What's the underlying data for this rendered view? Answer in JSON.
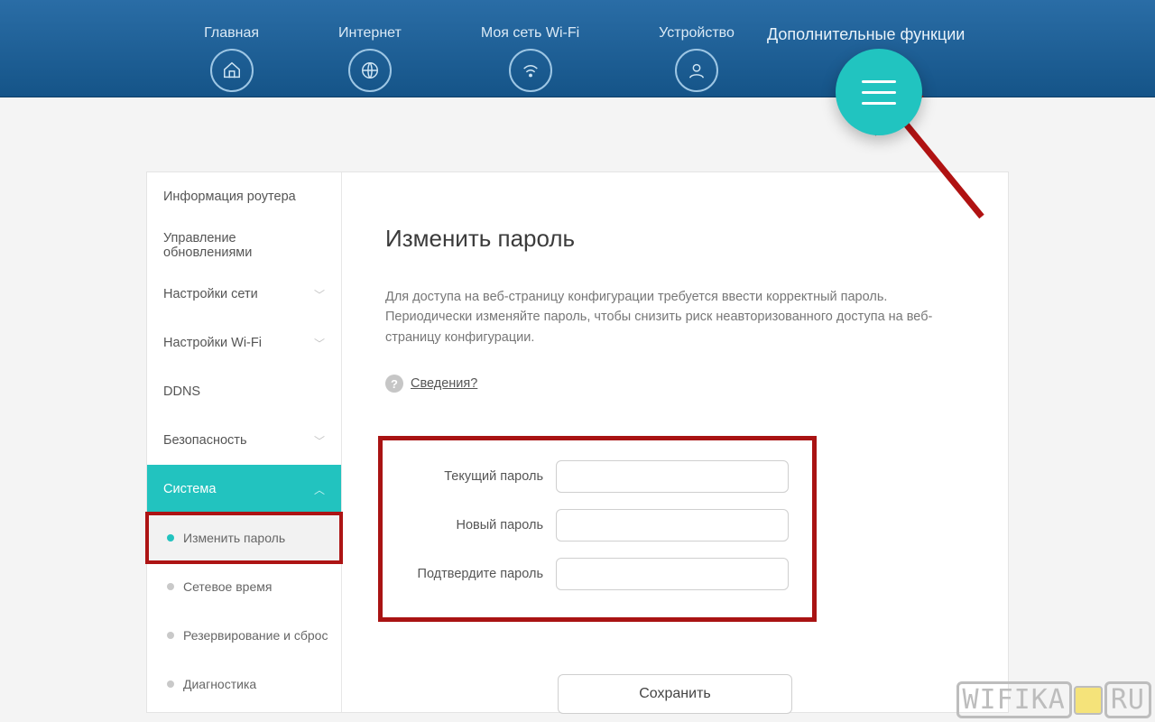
{
  "topnav": {
    "items": [
      {
        "label": "Главная"
      },
      {
        "label": "Интернет"
      },
      {
        "label": "Моя сеть Wi-Fi"
      },
      {
        "label": "Устройство"
      }
    ],
    "extra_label": "Дополнительные функции"
  },
  "sidebar": {
    "items": [
      {
        "label": "Информация роутера",
        "expandable": false
      },
      {
        "label": "Управление обновлениями",
        "expandable": false
      },
      {
        "label": "Настройки сети",
        "expandable": true
      },
      {
        "label": "Настройки Wi-Fi",
        "expandable": true
      },
      {
        "label": "DDNS",
        "expandable": false
      },
      {
        "label": "Безопасность",
        "expandable": true
      }
    ],
    "active_group": "Система",
    "sub_items": [
      {
        "label": "Изменить пароль",
        "selected": true
      },
      {
        "label": "Сетевое время"
      },
      {
        "label": "Резервирование и сброс"
      },
      {
        "label": "Диагностика"
      }
    ]
  },
  "page": {
    "title": "Изменить пароль",
    "description": "Для доступа на веб-страницу конфигурации требуется ввести корректный пароль. Периодически изменяйте пароль, чтобы снизить риск неавторизованного доступа на веб-страницу конфигурации.",
    "info_link": "Сведения?",
    "labels": {
      "current": "Текущий пароль",
      "new": "Новый пароль",
      "confirm": "Подтвердите пароль"
    },
    "save": "Сохранить"
  },
  "watermark": {
    "text1": "WIFIKA",
    "text2": "RU"
  }
}
